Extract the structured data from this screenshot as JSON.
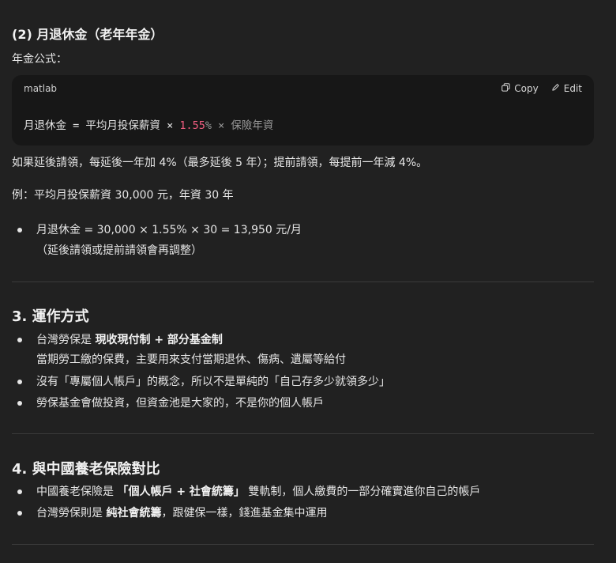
{
  "section2": {
    "title": "(2) 月退休金（老年年金）",
    "formula_label": "年金公式：",
    "code": {
      "lang": "matlab",
      "copy_label": "Copy",
      "edit_label": "Edit",
      "lhs": "月退休金",
      "eq": "=",
      "term1": "平均月投保薪資",
      "times1": "×",
      "rate": "1.55",
      "percent": "%",
      "times2": "×",
      "term2": "保險年資"
    },
    "note": "如果延後請領，每延後一年加 4%（最多延後 5 年）；提前請領，每提前一年減 4%。",
    "example": "例：平均月投保薪資 30,000 元，年資 30 年",
    "bullet_line1": "月退休金 = 30,000 × 1.55% × 30 = 13,950 元/月",
    "bullet_line2": "（延後請領或提前請領會再調整）"
  },
  "section3": {
    "title": "3. 運作方式",
    "item1_prefix": "台灣勞保是 ",
    "item1_bold": "現收現付制 + 部分基金制",
    "item1_sub": "當期勞工繳的保費，主要用來支付當期退休、傷病、遺屬等給付",
    "item2": "沒有「專屬個人帳戶」的概念，所以不是單純的「自己存多少就領多少」",
    "item3": "勞保基金會做投資，但資金池是大家的，不是你的個人帳戶"
  },
  "section4": {
    "title": "4. 與中國養老保險對比",
    "item1_prefix": "中國養老保險是 ",
    "item1_bold": "「個人帳戶 + 社會統籌」",
    "item1_suffix": " 雙軌制，個人繳費的一部分確實進你自己的帳戶",
    "item2_prefix": "台灣勞保則是 ",
    "item2_bold": "純社會統籌",
    "item2_suffix": "，跟健保一樣，錢進基金集中運用"
  }
}
